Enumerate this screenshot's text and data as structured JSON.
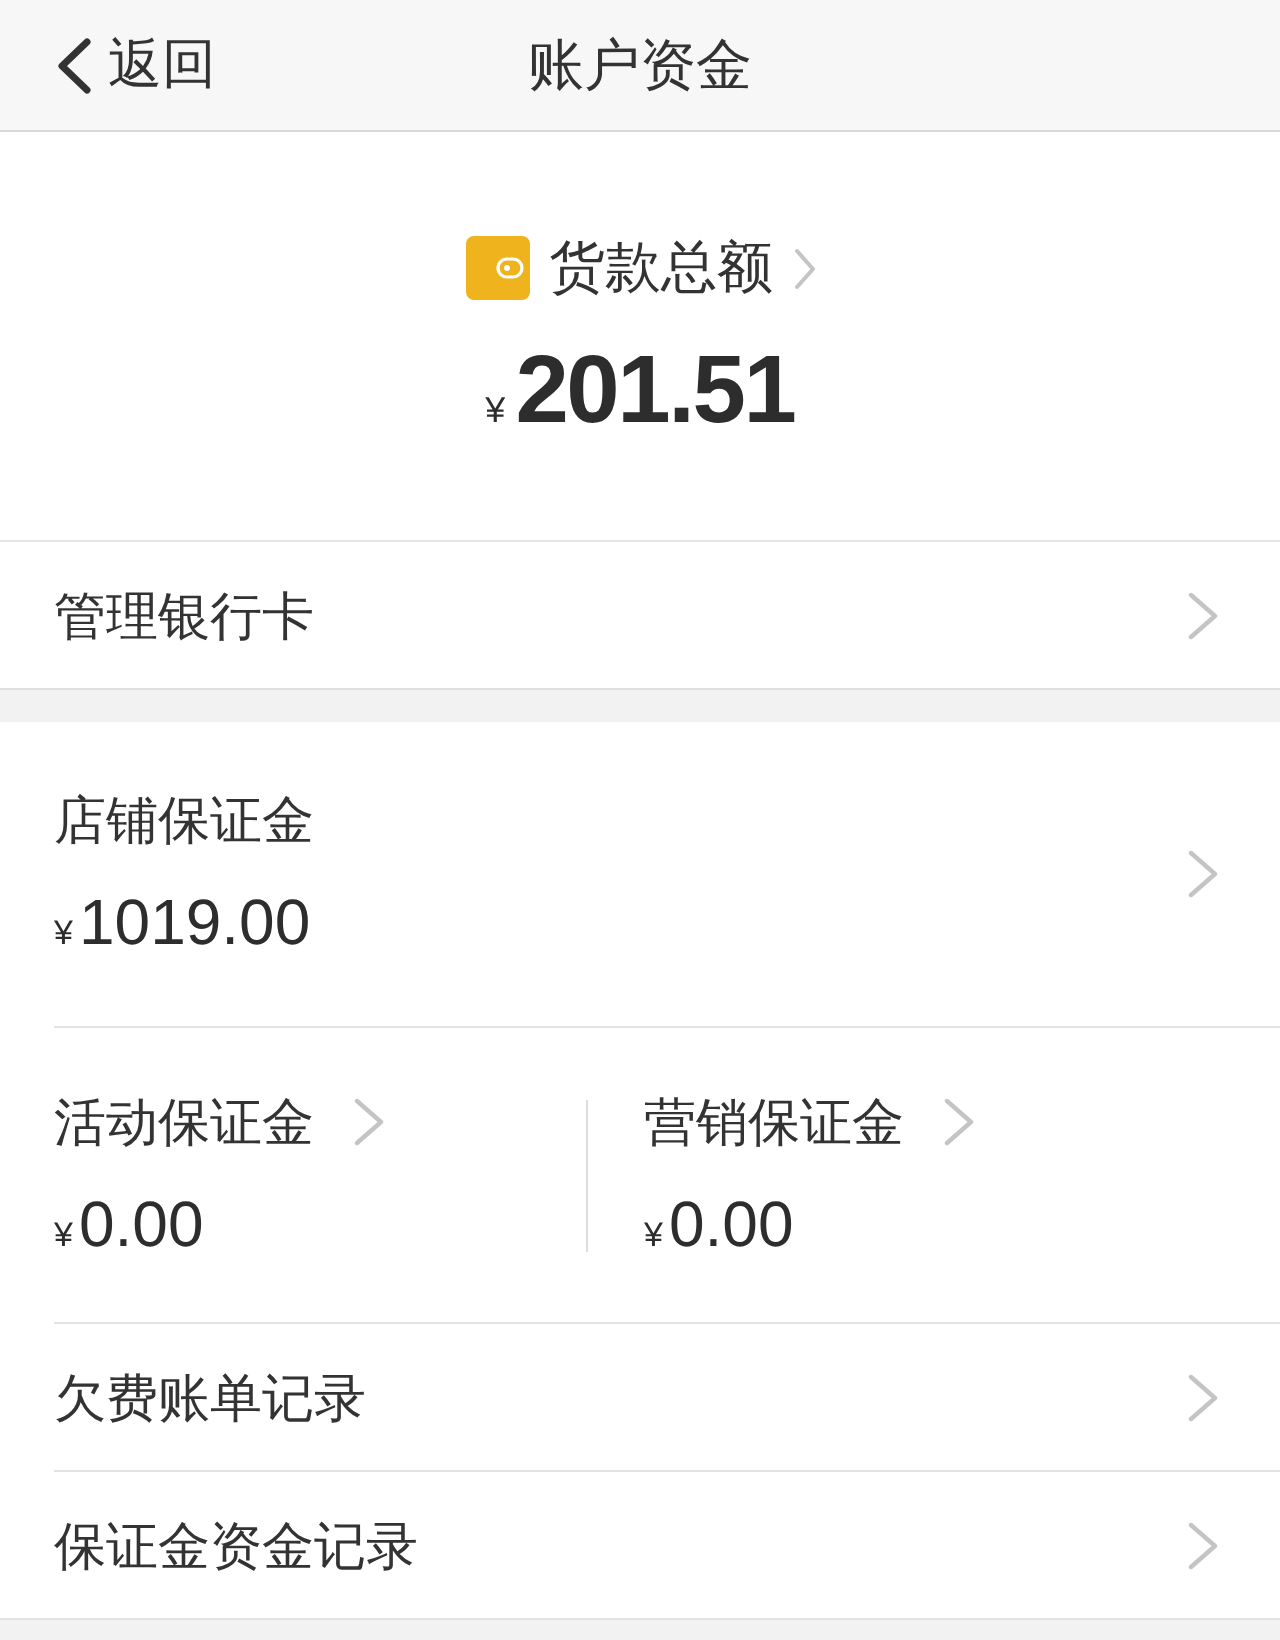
{
  "nav_bar": {
    "back_label": "返回",
    "title": "账户资金"
  },
  "balance": {
    "label": "货款总额",
    "currency": "¥",
    "amount": "201.51"
  },
  "bank_card_row": {
    "label": "管理银行卡"
  },
  "deposits": {
    "main": {
      "label": "店铺保证金",
      "currency": "¥",
      "amount": "1019.00"
    },
    "split": [
      {
        "label": "活动保证金",
        "currency": "¥",
        "amount": "0.00"
      },
      {
        "label": "营销保证金",
        "currency": "¥",
        "amount": "0.00"
      }
    ]
  },
  "record_rows": [
    {
      "label": "欠费账单记录"
    },
    {
      "label": "保证金资金记录"
    }
  ]
}
